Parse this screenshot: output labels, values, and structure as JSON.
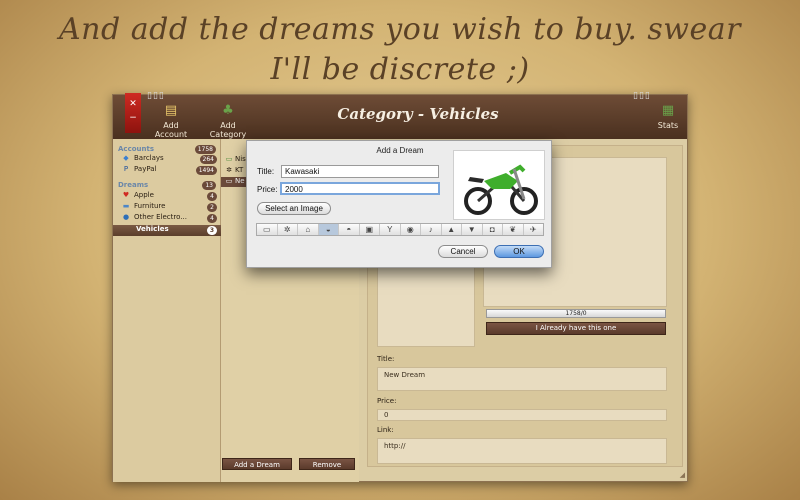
{
  "headline": "And add the dreams you wish to buy. swear I'll be discrete ;)",
  "toolbar": {
    "add_account": "Add Account",
    "add_category": "Add Category",
    "title": "Category - Vehicles",
    "stats": "Stats"
  },
  "sidebar": {
    "accounts_header": "Accounts",
    "accounts_count": "1758",
    "accounts": [
      {
        "label": "Barclays",
        "count": "264",
        "icon": "shield-icon"
      },
      {
        "label": "PayPal",
        "count": "1494",
        "icon": "paypal-icon"
      }
    ],
    "dreams_header": "Dreams",
    "dreams_count": "13",
    "dreams": [
      {
        "label": "Apple",
        "count": "4",
        "icon": "apple-icon"
      },
      {
        "label": "Furniture",
        "count": "2",
        "icon": "furniture-icon"
      },
      {
        "label": "Other Electro...",
        "count": "4",
        "icon": "globe-icon"
      },
      {
        "label": "Vehicles",
        "count": "3",
        "icon": "vehicle-icon"
      }
    ]
  },
  "list": {
    "items": [
      "Nis",
      "KT",
      "Ne"
    ],
    "add_button": "Add a Dream",
    "remove_button": "Remove"
  },
  "detail": {
    "progress_text": "1758/0",
    "already_have": "I Already have this one",
    "title_label": "Title:",
    "title_value": "New Dream",
    "price_label": "Price:",
    "price_value": "0",
    "link_label": "Link:",
    "link_value": "http://"
  },
  "dialog": {
    "title": "Add a Dream",
    "title_label": "Title:",
    "title_value": "Kawasaki",
    "price_label": "Price:",
    "price_value": "2000",
    "select_image": "Select an Image",
    "cancel": "Cancel",
    "ok": "OK",
    "active_icon_index": 3,
    "category_icons": [
      "laptop-icon",
      "gear-icon",
      "house-icon",
      "car-icon",
      "cake-icon",
      "gift-icon",
      "cocktail-icon",
      "pan-icon",
      "guitar-icon",
      "tree-icon",
      "shirt-icon",
      "camera-icon",
      "leaf-icon",
      "plane-icon"
    ]
  },
  "colors": {
    "toolbar": "#5a3b28",
    "selection": "#6b4a3a",
    "ok_button": "#5d98e0",
    "bookmark": "#cf2a22"
  }
}
